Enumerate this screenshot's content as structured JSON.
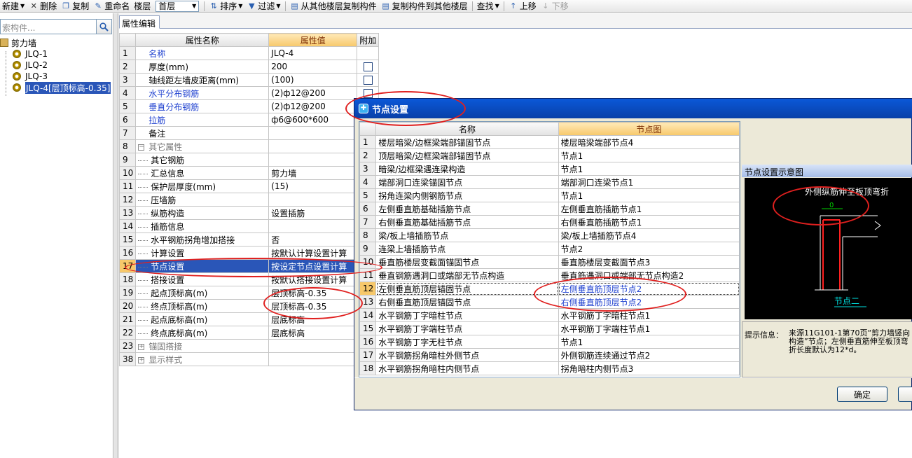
{
  "toolbar": {
    "new": "新建",
    "delete": "删除",
    "copy": "复制",
    "rename": "重命名",
    "floor_label": "楼层",
    "floor_value": "首层",
    "sort": "排序",
    "filter": "过滤",
    "copy_from_other": "从其他楼层复制构件",
    "copy_to_other": "复制构件到其他楼层",
    "find": "查找",
    "move_up": "上移",
    "move_down": "下移"
  },
  "left": {
    "search_placeholder": "索构件...",
    "root": "剪力墙",
    "items": [
      "JLQ-1",
      "JLQ-2",
      "JLQ-3",
      "JLQ-4[层顶标高-0.35]"
    ]
  },
  "props": {
    "tab": "属性编辑",
    "headers": [
      "属性名称",
      "属性值",
      "附加"
    ],
    "rows": [
      {
        "num": "1",
        "name": "名称",
        "value": "JLQ-4"
      },
      {
        "num": "2",
        "name": "厚度(mm)",
        "value": "200"
      },
      {
        "num": "3",
        "name": "轴线距左墙皮距离(mm)",
        "value": "(100)"
      },
      {
        "num": "4",
        "name": "水平分布钢筋",
        "value": "(2)ф12@200"
      },
      {
        "num": "5",
        "name": "垂直分布钢筋",
        "value": "(2)ф12@200"
      },
      {
        "num": "6",
        "name": "拉筋",
        "value": "ф6@600*600"
      },
      {
        "num": "7",
        "name": "备注",
        "value": ""
      },
      {
        "num": "8",
        "name": "其它属性",
        "value": ""
      },
      {
        "num": "9",
        "name": "其它钢筋",
        "value": ""
      },
      {
        "num": "10",
        "name": "汇总信息",
        "value": "剪力墙"
      },
      {
        "num": "11",
        "name": "保护层厚度(mm)",
        "value": "(15)"
      },
      {
        "num": "12",
        "name": "压墙筋",
        "value": ""
      },
      {
        "num": "13",
        "name": "纵筋构造",
        "value": "设置插筋"
      },
      {
        "num": "14",
        "name": "插筋信息",
        "value": ""
      },
      {
        "num": "15",
        "name": "水平钢筋拐角增加搭接",
        "value": "否"
      },
      {
        "num": "16",
        "name": "计算设置",
        "value": "按默认计算设置计算"
      },
      {
        "num": "17",
        "name": "节点设置",
        "value": "按设定节点设置计算"
      },
      {
        "num": "18",
        "name": "搭接设置",
        "value": "按默认搭接设置计算"
      },
      {
        "num": "19",
        "name": "起点顶标高(m)",
        "value": "层顶标高-0.35"
      },
      {
        "num": "20",
        "name": "终点顶标高(m)",
        "value": "层顶标高-0.35"
      },
      {
        "num": "21",
        "name": "起点底标高(m)",
        "value": "层底标高"
      },
      {
        "num": "22",
        "name": "终点底标高(m)",
        "value": "层底标高"
      },
      {
        "num": "23",
        "name": "锚固搭接",
        "value": ""
      },
      {
        "num": "38",
        "name": "显示样式",
        "value": ""
      }
    ]
  },
  "dialog": {
    "title": "节点设置",
    "headers": [
      "名称",
      "节点图"
    ],
    "rows": [
      {
        "num": "1",
        "name": "楼层暗梁/边框梁端部锚固节点",
        "node": "楼层暗梁端部节点4"
      },
      {
        "num": "2",
        "name": "顶层暗梁/边框梁端部锚固节点",
        "node": "节点1"
      },
      {
        "num": "3",
        "name": "暗梁/边框梁遇连梁构造",
        "node": "节点1"
      },
      {
        "num": "4",
        "name": "端部洞口连梁锚固节点",
        "node": "端部洞口连梁节点1"
      },
      {
        "num": "5",
        "name": "拐角连梁内侧钢筋节点",
        "node": "节点1"
      },
      {
        "num": "6",
        "name": "左侧垂直筋基础插筋节点",
        "node": "左侧垂直筋插筋节点1"
      },
      {
        "num": "7",
        "name": "右侧垂直筋基础插筋节点",
        "node": "右侧垂直筋插筋节点1"
      },
      {
        "num": "8",
        "name": "梁/板上墙插筋节点",
        "node": "梁/板上墙插筋节点4"
      },
      {
        "num": "9",
        "name": "连梁上墙插筋节点",
        "node": "节点2"
      },
      {
        "num": "10",
        "name": "垂直筋楼层变截面锚固节点",
        "node": "垂直筋楼层变截面节点3"
      },
      {
        "num": "11",
        "name": "垂直钢筋遇洞口或端部无节点构造",
        "node": "垂直筋遇洞口或端部无节点构造2"
      },
      {
        "num": "12",
        "name": "左侧垂直筋顶层锚固节点",
        "node": "左侧垂直筋顶层节点2"
      },
      {
        "num": "13",
        "name": "右侧垂直筋顶层锚固节点",
        "node": "右侧垂直筋顶层节点2"
      },
      {
        "num": "14",
        "name": "水平钢筋丁字暗柱节点",
        "node": "水平钢筋丁字暗柱节点1"
      },
      {
        "num": "15",
        "name": "水平钢筋丁字端柱节点",
        "node": "水平钢筋丁字端柱节点1"
      },
      {
        "num": "16",
        "name": "水平钢筋丁字无柱节点",
        "node": "节点1"
      },
      {
        "num": "17",
        "name": "水平钢筋拐角暗柱外侧节点",
        "node": "外侧钢筋连续通过节点2"
      },
      {
        "num": "18",
        "name": "水平钢筋拐角暗柱内侧节点",
        "node": "拐角暗柱内侧节点3"
      }
    ],
    "preview_title": "节点设置示意图",
    "preview_caption": "外侧纵筋伸至板顶弯折",
    "preview_dim": "0",
    "preview_node_label": "节点二",
    "hint_label": "提示信息：",
    "hint_text": "来源11G101-1第70页“剪力墙竖向构造”节点；左侧垂直筋伸至板顶弯折长度默认为12*d。",
    "ok": "确定"
  },
  "colors": {
    "title_bar": "#0b58d8",
    "selection": "#2a56b8",
    "header_accent": "#f7c86a",
    "annotation": "#e0201f"
  }
}
